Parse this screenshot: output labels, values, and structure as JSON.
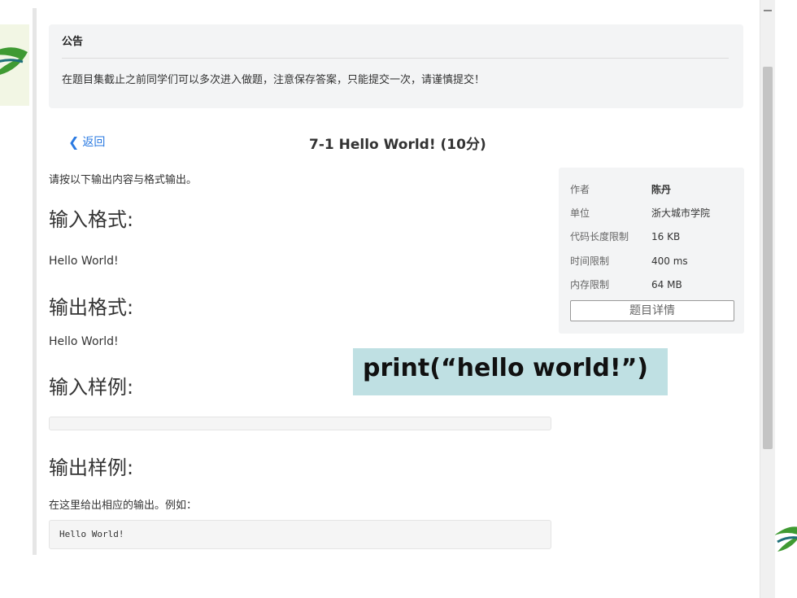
{
  "notice": {
    "title": "公告",
    "text": "在题目集截止之前同学们可以多次进入做题，注意保存答案，只能提交一次，请谨慎提交！"
  },
  "header": {
    "back_label": "返回",
    "problem_title": "7-1 Hello World! (10分)"
  },
  "problem": {
    "description": "请按以下输出内容与格式输出。",
    "input_heading": "输入格式:",
    "input_text": "Hello World!",
    "output_heading": "输出格式:",
    "output_text": "Hello World!",
    "sample_input_heading": "输入样例:",
    "sample_input_code": "",
    "sample_output_heading": "输出样例:",
    "sample_output_desc": "在这里给出相应的输出。例如：",
    "sample_output_code": "Hello World!"
  },
  "info": {
    "rows": [
      {
        "key": "作者",
        "value": "陈丹"
      },
      {
        "key": "单位",
        "value": "浙大城市学院"
      },
      {
        "key": "代码长度限制",
        "value": "16 KB"
      },
      {
        "key": "时间限制",
        "value": "400 ms"
      },
      {
        "key": "内存限制",
        "value": "64 MB"
      }
    ],
    "detail_button": "题目详情"
  },
  "overlay": {
    "text": "print(“hello world!”)"
  },
  "icons": {
    "back": "chevron-left-icon"
  },
  "colors": {
    "link": "#2a7ae2",
    "panel": "#f3f4f5",
    "overlay": "#bfe0e3"
  }
}
